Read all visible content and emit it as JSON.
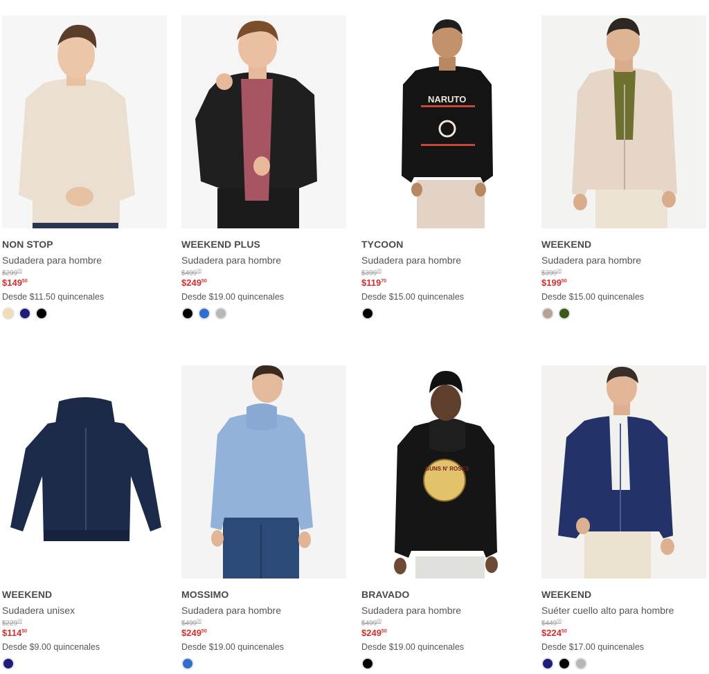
{
  "products": [
    {
      "brand": "NON STOP",
      "name": "Sudadera para hombre",
      "old_price_main": "$299",
      "old_price_cents": "00",
      "price_main": "$149",
      "price_cents": "50",
      "installments": "Desde $11.50 quincenales",
      "swatches": [
        "#f3dcb4",
        "#1e1e7a",
        "#000000"
      ]
    },
    {
      "brand": "WEEKEND PLUS",
      "name": "Sudadera para hombre",
      "old_price_main": "$499",
      "old_price_cents": "00",
      "price_main": "$249",
      "price_cents": "50",
      "installments": "Desde $19.00 quincenales",
      "swatches": [
        "#000000",
        "#2f6fd0",
        "#b8b8b8"
      ]
    },
    {
      "brand": "TYCOON",
      "name": "Sudadera para hombre",
      "old_price_main": "$399",
      "old_price_cents": "00",
      "price_main": "$119",
      "price_cents": "70",
      "installments": "Desde $15.00 quincenales",
      "swatches": [
        "#000000"
      ]
    },
    {
      "brand": "WEEKEND",
      "name": "Sudadera para hombre",
      "old_price_main": "$399",
      "old_price_cents": "00",
      "price_main": "$199",
      "price_cents": "50",
      "installments": "Desde $15.00 quincenales",
      "swatches": [
        "#b5a493",
        "#3b5a1a"
      ]
    },
    {
      "brand": "WEEKEND",
      "name": "Sudadera unisex",
      "old_price_main": "$229",
      "old_price_cents": "00",
      "price_main": "$114",
      "price_cents": "50",
      "installments": "Desde $9.00 quincenales",
      "swatches": [
        "#1e1e7a"
      ]
    },
    {
      "brand": "MOSSIMO",
      "name": "Sudadera para hombre",
      "old_price_main": "$499",
      "old_price_cents": "00",
      "price_main": "$249",
      "price_cents": "50",
      "installments": "Desde $19.00 quincenales",
      "swatches": [
        "#2f6fd0"
      ]
    },
    {
      "brand": "BRAVADO",
      "name": "Sudadera para hombre",
      "old_price_main": "$499",
      "old_price_cents": "00",
      "price_main": "$249",
      "price_cents": "50",
      "installments": "Desde $19.00 quincenales",
      "swatches": [
        "#000000"
      ]
    },
    {
      "brand": "WEEKEND",
      "name": "Suéter cuello alto para hombre",
      "old_price_main": "$449",
      "old_price_cents": "00",
      "price_main": "$224",
      "price_cents": "50",
      "installments": "Desde $17.00 quincenales",
      "swatches": [
        "#1e1e7a",
        "#000000",
        "#b8b8b8"
      ]
    }
  ],
  "photo_graphics": [
    "NARUTO",
    "GUNS N' ROSES"
  ],
  "colors": {
    "sale_price": "#d32f2f",
    "brand_text": "#4a4a4a",
    "photo_bg": "#f3f3f3"
  },
  "icons": [
    "product-photo",
    "color-swatch"
  ]
}
